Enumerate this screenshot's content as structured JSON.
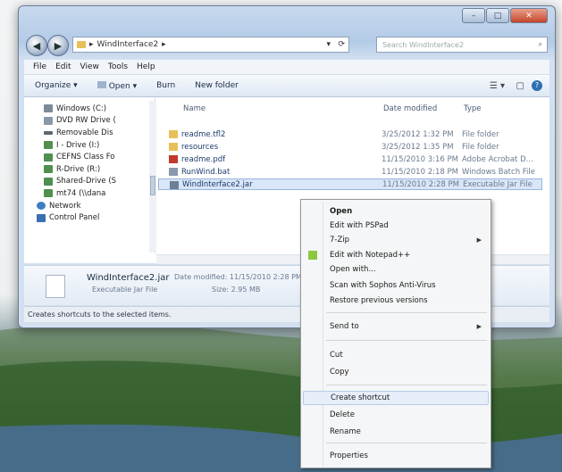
{
  "window": {
    "address_path": "WindInterface2",
    "search_placeholder": "Search WindInterface2",
    "caption_minimize": "–",
    "caption_maximize": "□",
    "caption_close": "✕"
  },
  "menubar": [
    "File",
    "Edit",
    "View",
    "Tools",
    "Help"
  ],
  "toolbar": {
    "organize": "Organize ▾",
    "open": "Open ▾",
    "burn": "Burn",
    "new_folder": "New folder"
  },
  "navpane": {
    "items": [
      {
        "label": "Windows (C:)",
        "icon": "drive-icon",
        "color": "#7d8a99"
      },
      {
        "label": "DVD RW Drive (",
        "icon": "dvd-drive-icon",
        "color": "#8a97a7"
      },
      {
        "label": "Removable Dis",
        "icon": "removable-disk-icon",
        "color": "#5c6672"
      },
      {
        "label": "I - Drive (I:)",
        "icon": "network-drive-icon",
        "color": "#4f8f4f"
      },
      {
        "label": "CEFNS Class Fo",
        "icon": "network-drive-icon",
        "color": "#4f8f4f"
      },
      {
        "label": "R-Drive (R:)",
        "icon": "network-drive-icon",
        "color": "#4f8f4f"
      },
      {
        "label": "Shared-Drive (S",
        "icon": "network-drive-icon",
        "color": "#4f8f4f"
      },
      {
        "label": "mt74 (\\\\dana",
        "icon": "network-drive-icon",
        "color": "#4f8f4f"
      },
      {
        "label": "Network",
        "icon": "network-icon",
        "color": "#3c7fc1"
      },
      {
        "label": "Control Panel",
        "icon": "control-panel-icon",
        "color": "#3a6fb0"
      }
    ]
  },
  "filelist": {
    "headers": {
      "name": "Name",
      "date": "Date modified",
      "type": "Type"
    },
    "rows": [
      {
        "name": "readme.tfl2",
        "date": "3/25/2012 1:32 PM",
        "type": "File folder",
        "icon": "folder-icon",
        "color": "#e8c05a"
      },
      {
        "name": "resources",
        "date": "3/25/2012 1:35 PM",
        "type": "File folder",
        "icon": "folder-icon",
        "color": "#e8c05a"
      },
      {
        "name": "readme.pdf",
        "date": "11/15/2010 3:16 PM",
        "type": "Adobe Acrobat D...",
        "icon": "pdf-icon",
        "color": "#c0392b"
      },
      {
        "name": "RunWind.bat",
        "date": "11/15/2010 2:18 PM",
        "type": "Windows Batch File",
        "icon": "batch-file-icon",
        "color": "#8a99ab"
      },
      {
        "name": "WindInterface2.jar",
        "date": "11/15/2010 2:28 PM",
        "type": "Executable Jar File",
        "icon": "jar-icon",
        "color": "#6c7f95",
        "selected": true
      }
    ]
  },
  "details": {
    "name": "WindInterface2.jar",
    "date_label": "Date modified: 11/15/2010 2:28 PM",
    "type": "Executable Jar File",
    "size": "Size: 2.95 MB"
  },
  "status": "Creates shortcuts to the selected items.",
  "context_menu": {
    "items": [
      {
        "label": "Open",
        "bold": true
      },
      {
        "label": "Edit with PSPad"
      },
      {
        "label": "7-Zip",
        "submenu": true
      },
      {
        "label": "Edit with Notepad++",
        "icon": "notepad-plus-icon"
      },
      {
        "label": "Open with..."
      },
      {
        "label": "Scan with Sophos Anti-Virus"
      },
      {
        "label": "Restore previous versions"
      },
      {
        "label": "Send to",
        "submenu": true,
        "sep_before": true
      },
      {
        "label": "Cut",
        "sep_before": true
      },
      {
        "label": "Copy"
      },
      {
        "label": "Create shortcut",
        "sep_before": true,
        "hot": true
      },
      {
        "label": "Delete"
      },
      {
        "label": "Rename"
      },
      {
        "label": "Properties",
        "sep_before": true
      }
    ]
  },
  "colors": {
    "selection": "#d8e6f8",
    "titlebar": "#b4cbe6",
    "accent": "#3c7fc1"
  }
}
